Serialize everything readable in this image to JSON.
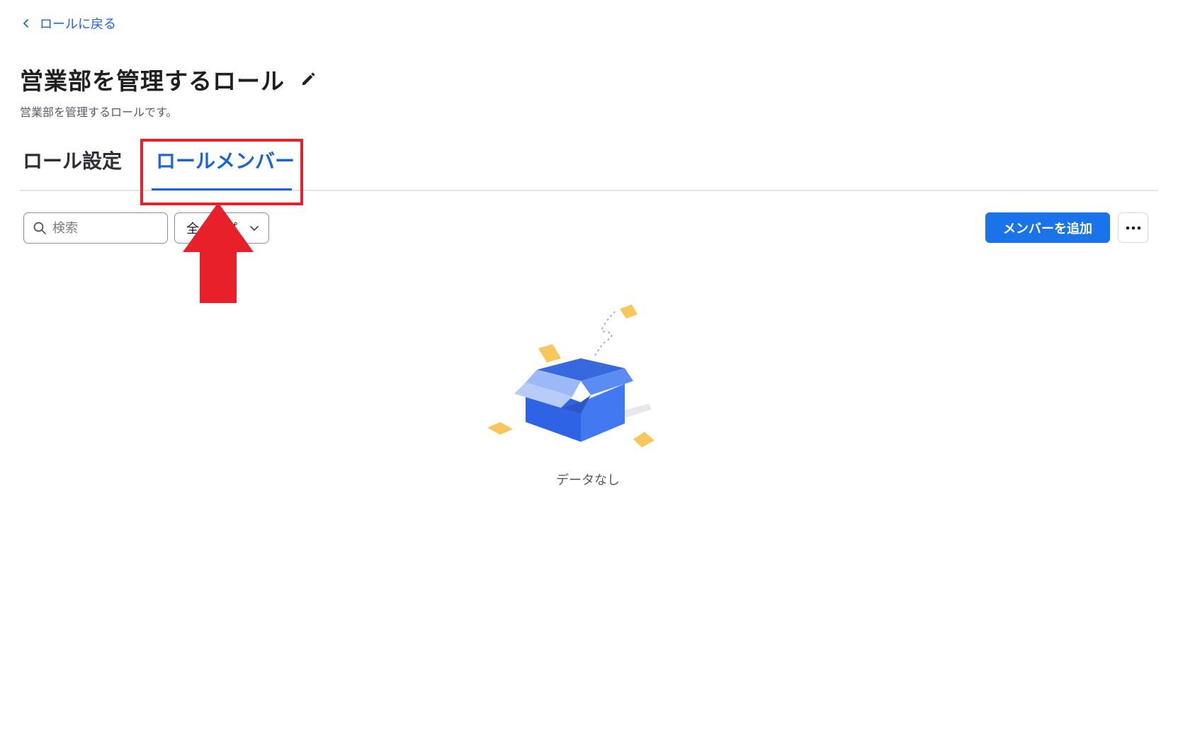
{
  "back_link": {
    "label": "ロールに戻る"
  },
  "page": {
    "title": "営業部を管理するロール",
    "description": "営業部を管理するロールです。"
  },
  "tabs": [
    {
      "label": "ロール設定",
      "active": false
    },
    {
      "label": "ロールメンバー",
      "active": true
    }
  ],
  "toolbar": {
    "search_placeholder": "検索",
    "type_select_value": "全タイプ",
    "add_member_label": "メンバーを追加"
  },
  "empty_state": {
    "text": "データなし"
  },
  "colors": {
    "accent": "#1a73e8",
    "highlight": "#e8202a"
  }
}
